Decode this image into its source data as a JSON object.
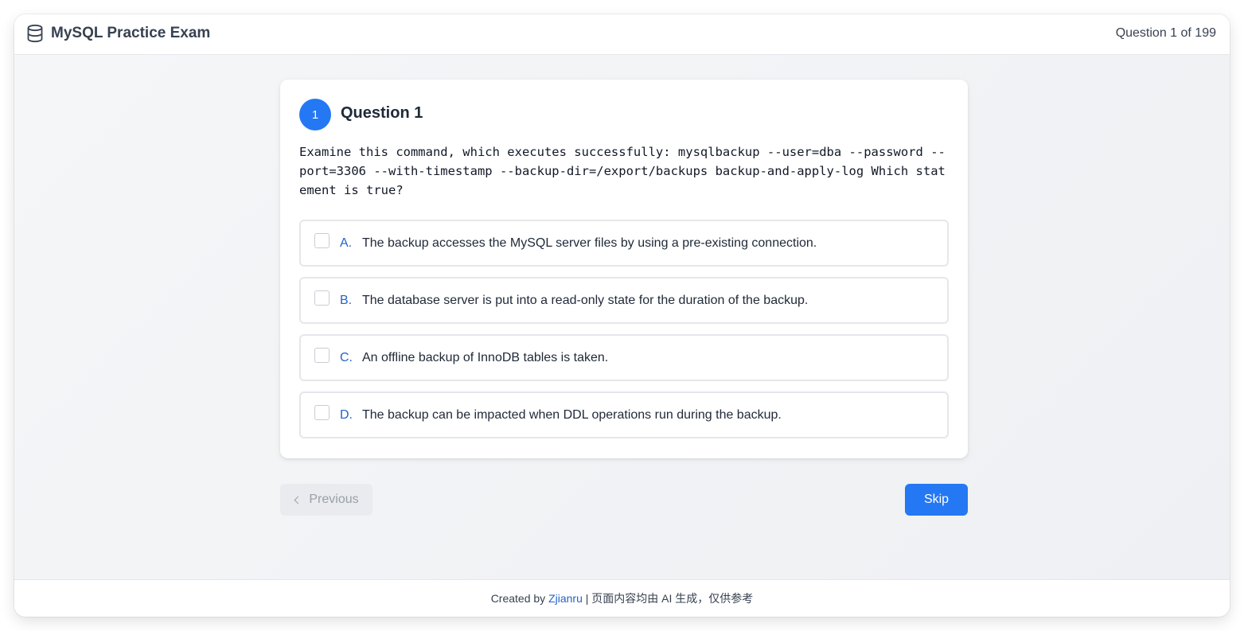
{
  "header": {
    "icon": "database-icon",
    "title": "MySQL Practice Exam",
    "counter": "Question 1 of 199"
  },
  "question": {
    "number": "1",
    "title": "Question 1",
    "text": "Examine this command, which executes successfully: mysqlbackup --user=dba --password --port=3306 --with-timestamp --backup-dir=/export/backups backup-and-apply-log Which statement is true?"
  },
  "options": [
    {
      "letter": "A.",
      "text": "The backup accesses the MySQL server files by using a pre-existing connection."
    },
    {
      "letter": "B.",
      "text": "The database server is put into a read-only state for the duration of the backup."
    },
    {
      "letter": "C.",
      "text": "An offline backup of InnoDB tables is taken."
    },
    {
      "letter": "D.",
      "text": "The backup can be impacted when DDL operations run during the backup."
    }
  ],
  "nav": {
    "previous_label": "Previous",
    "skip_label": "Skip"
  },
  "footer": {
    "prefix": "Created by",
    "author": "Zjianru",
    "suffix": "| 页面内容均由 AI 生成，仅供参考"
  },
  "colors": {
    "accent": "#2478f3",
    "link": "#2563c9"
  }
}
